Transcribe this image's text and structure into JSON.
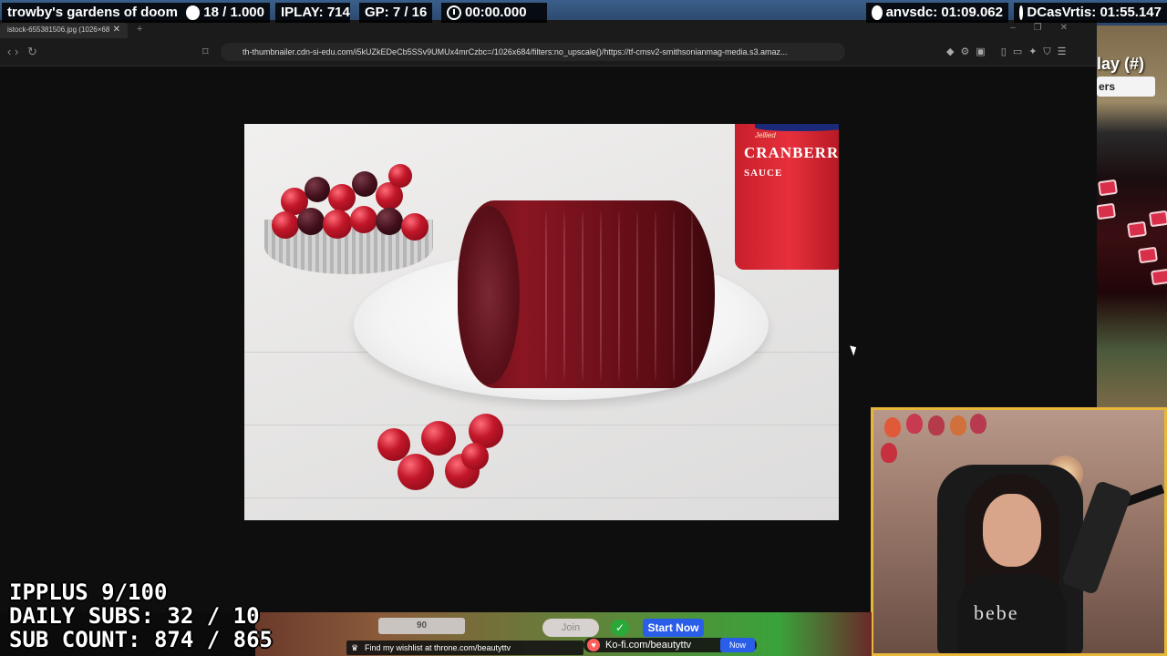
{
  "topbar": {
    "garden": "trowby's gardens of doom",
    "counter": "18 / 1.000",
    "iplay": "IPLAY: 714",
    "gp": "GP: 7 / 16",
    "timer": "00:00.000",
    "record1": "anvsdc: 01:09.062",
    "record2": "DCasVrtis: 01:55.147"
  },
  "browser": {
    "tab_title": "istock-655381506.jpg (1026×68",
    "url": "th-thumbnailer.cdn-si-edu.com/i5kUZkEDeCb5SSv9UMUx4mrCzbc=/1026x684/filters:no_upscale()/https://tf-cmsv2-smithsonianmag-media.s3.amaz..."
  },
  "photo": {
    "can_brand": "Jellied",
    "can_text": "CRANBERR",
    "can_sub": "SAUCE"
  },
  "right_scene": {
    "title": "lay (#)",
    "button": "ers"
  },
  "cam": {
    "shirt_text": "bebe"
  },
  "stats": {
    "line1": "IPPLUS 9/100",
    "line2": "DAILY SUBS: 32 / 10",
    "line3": "SUB COUNT: 874 / 865"
  },
  "bottom": {
    "box_value": "90",
    "join": "Join",
    "start": "Start Now",
    "wishlist": "Find my wishlist at throne.com/beautyttv",
    "kofi": "Ko-fi.com/beautyttv",
    "blue_btn": "Now"
  }
}
